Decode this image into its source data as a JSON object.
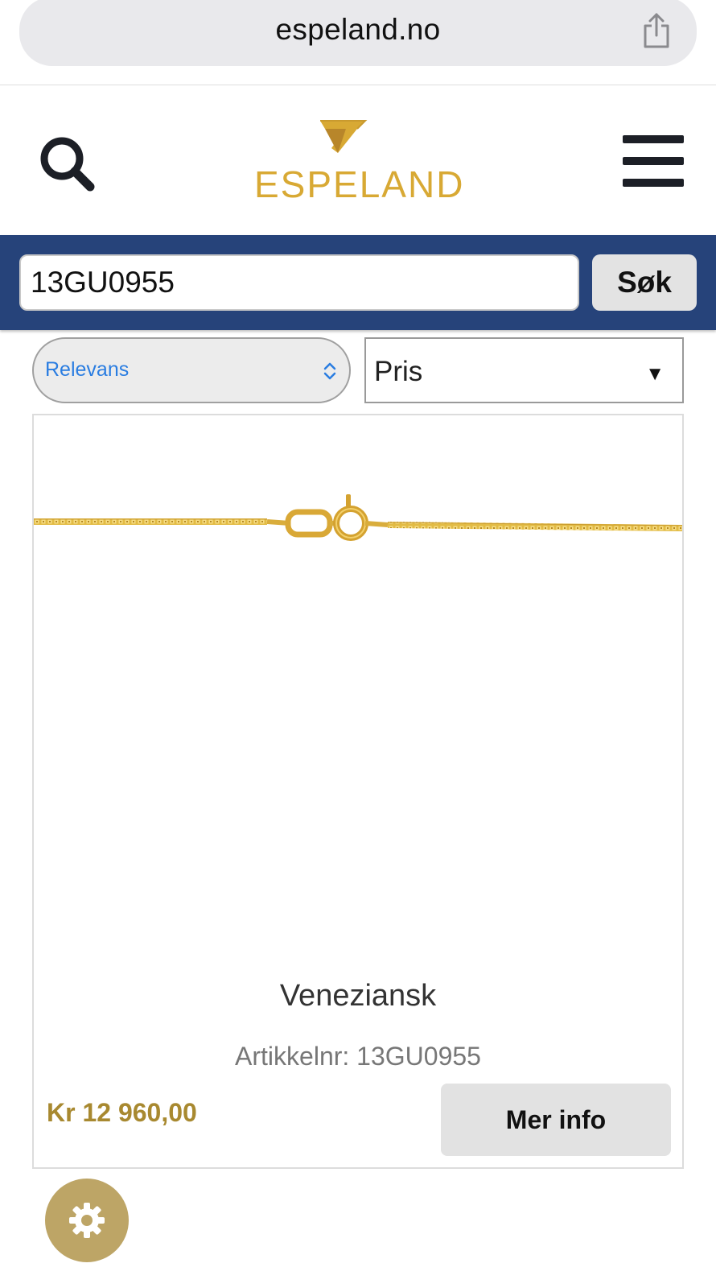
{
  "browser": {
    "url": "espeland.no"
  },
  "header": {
    "logo_text": "ESPELAND"
  },
  "search": {
    "value": "13GU0955",
    "button_label": "Søk"
  },
  "sort": {
    "relevance_label": "Relevans",
    "price_label": "Pris"
  },
  "product": {
    "name": "Veneziansk",
    "sku": "Artikkelnr: 13GU0955",
    "price": "Kr 12 960,00",
    "more_info_label": "Mer info"
  },
  "colors": {
    "brand_gold": "#d8a934",
    "search_band": "#26437a",
    "price_gold": "#a88930",
    "fab": "#bda566"
  },
  "icons": [
    "share-icon",
    "search-icon",
    "diamond-logo-icon",
    "hamburger-menu-icon",
    "chevron-updown-icon",
    "dropdown-arrow-icon",
    "gear-icon"
  ]
}
